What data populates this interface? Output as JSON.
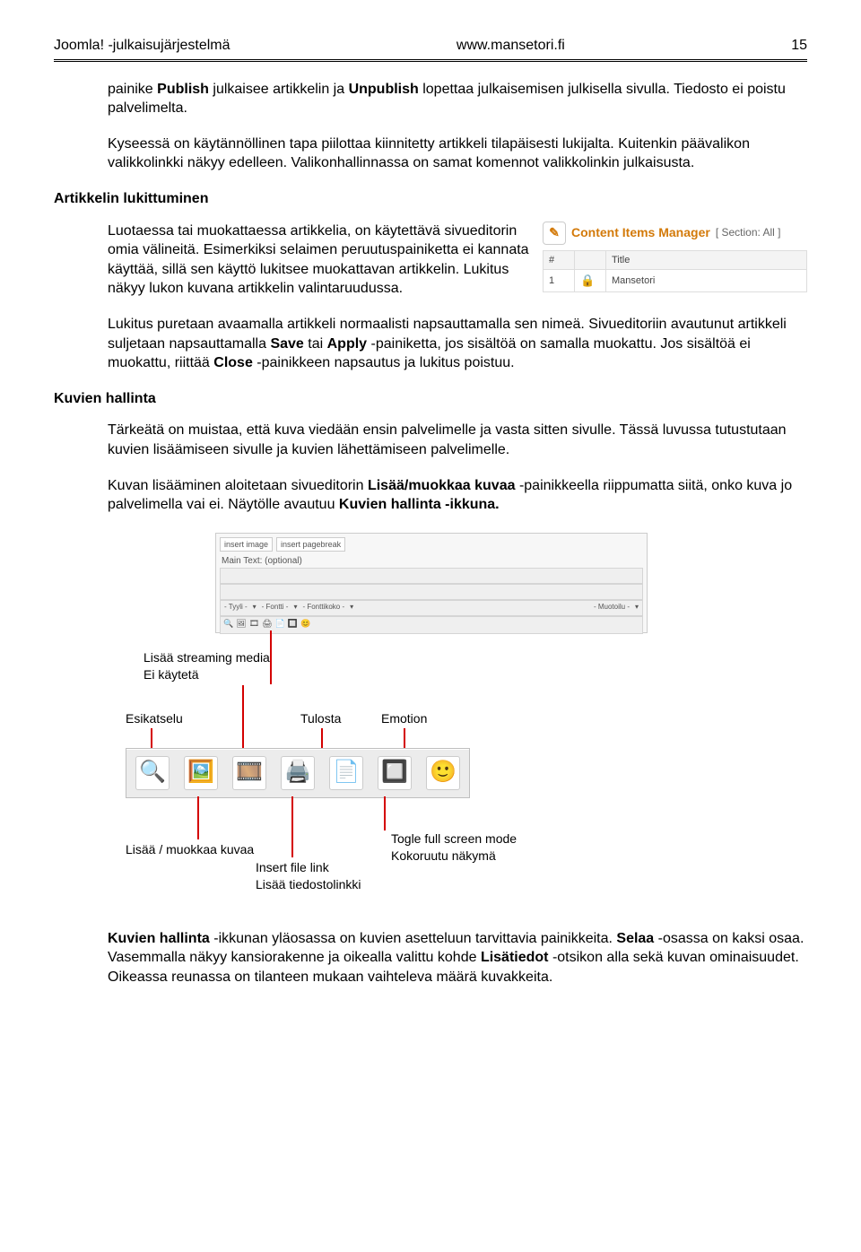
{
  "header": {
    "left": "Joomla! -julkaisujärjestelmä",
    "center": "www.mansetori.fi",
    "right": "15"
  },
  "p1_pre": "painike ",
  "p1_b1": "Publish",
  "p1_mid1": " julkaisee artikkelin ja ",
  "p1_b2": "Unpublish",
  "p1_post": " lopettaa julkaisemisen julkisella sivulla. Tiedosto ei poistu palvelimelta.",
  "p2": "Kyseessä on käytännöllinen tapa piilottaa kiinnitetty artikkeli tilapäisesti lukijalta. Kuitenkin päävalikon valikkolinkki näkyy edelleen. Valikonhallinnassa on samat komennot valikkolinkin julkaisusta.",
  "h1": "Artikkelin lukittuminen",
  "p3": "Luotaessa tai muokattaessa artikkelia, on käytettävä sivueditorin omia välineitä. Esimerkiksi selaimen peruutuspainiketta ei kannata käyttää, sillä sen käyttö lukitsee muokattavan artikkelin. Lukitus näkyy lukon kuvana artikkelin valintaruudussa.",
  "manager": {
    "title": "Content Items Manager",
    "section": "[ Section: All ]",
    "col_num": "#",
    "col_title": "Title",
    "row_num": "1",
    "row_title": "Mansetori"
  },
  "p4_a": "Lukitus puretaan avaamalla artikkeli normaalisti napsauttamalla sen nimeä. Sivueditoriin avautunut artikkeli suljetaan napsauttamalla ",
  "p4_b1": "Save",
  "p4_b": " tai ",
  "p4_b2": "Apply",
  "p4_c": " -painiketta, jos sisältöä on samalla muokattu. Jos sisältöä ei muokattu, riittää ",
  "p4_b3": "Close",
  "p4_d": " -painikkeen napsautus ja lukitus poistuu.",
  "h2": "Kuvien hallinta",
  "p5": "Tärkeätä on muistaa, että kuva viedään ensin palvelimelle ja vasta sitten sivulle. Tässä luvussa tutustutaan kuvien lisäämiseen sivulle ja kuvien lähettämiseen palvelimelle.",
  "p6_a": "Kuvan lisääminen aloitetaan sivueditorin ",
  "p6_b1": "Lisää/muokkaa kuvaa",
  "p6_b": " -painikkeella riippumatta siitä, onko kuva jo palvelimella vai ei. Näytölle avautuu ",
  "p6_b2": "Kuvien hallinta -ikkuna.",
  "editor": {
    "insert_image": "insert image",
    "insert_pagebreak": "insert pagebreak",
    "main_text": "Main Text: (optional)",
    "sel_style": "- Tyyli -",
    "sel_font": "- Fontti -",
    "sel_size": "- Fonttikoko -",
    "sel_format": "- Muotoilu -"
  },
  "callouts": {
    "stream1": "Lisää streaming media",
    "stream2": "Ei käytetä",
    "preview": "Esikatselu",
    "print": "Tulosta",
    "emotion": "Emotion",
    "edit_img": "Lisää / muokkaa kuvaa",
    "file_link1": "Insert file link",
    "file_link2": "Lisää tiedostolinkki",
    "fullscreen1": "Togle full screen mode",
    "fullscreen2": "Kokoruutu näkymä"
  },
  "p7_b1": "Kuvien hallinta",
  "p7_a": " -ikkunan yläosassa on kuvien asetteluun tarvittavia painikkeita. ",
  "p7_b2": "Selaa",
  "p7_b": " -osassa on kaksi osaa. Vasemmalla näkyy kansiorakenne ja oikealla valittu kohde ",
  "p7_b3": "Lisätiedot",
  "p7_c": " -otsikon alla sekä kuvan ominaisuudet. Oikeassa reunassa on tilanteen mukaan vaihteleva määrä kuvakkeita."
}
